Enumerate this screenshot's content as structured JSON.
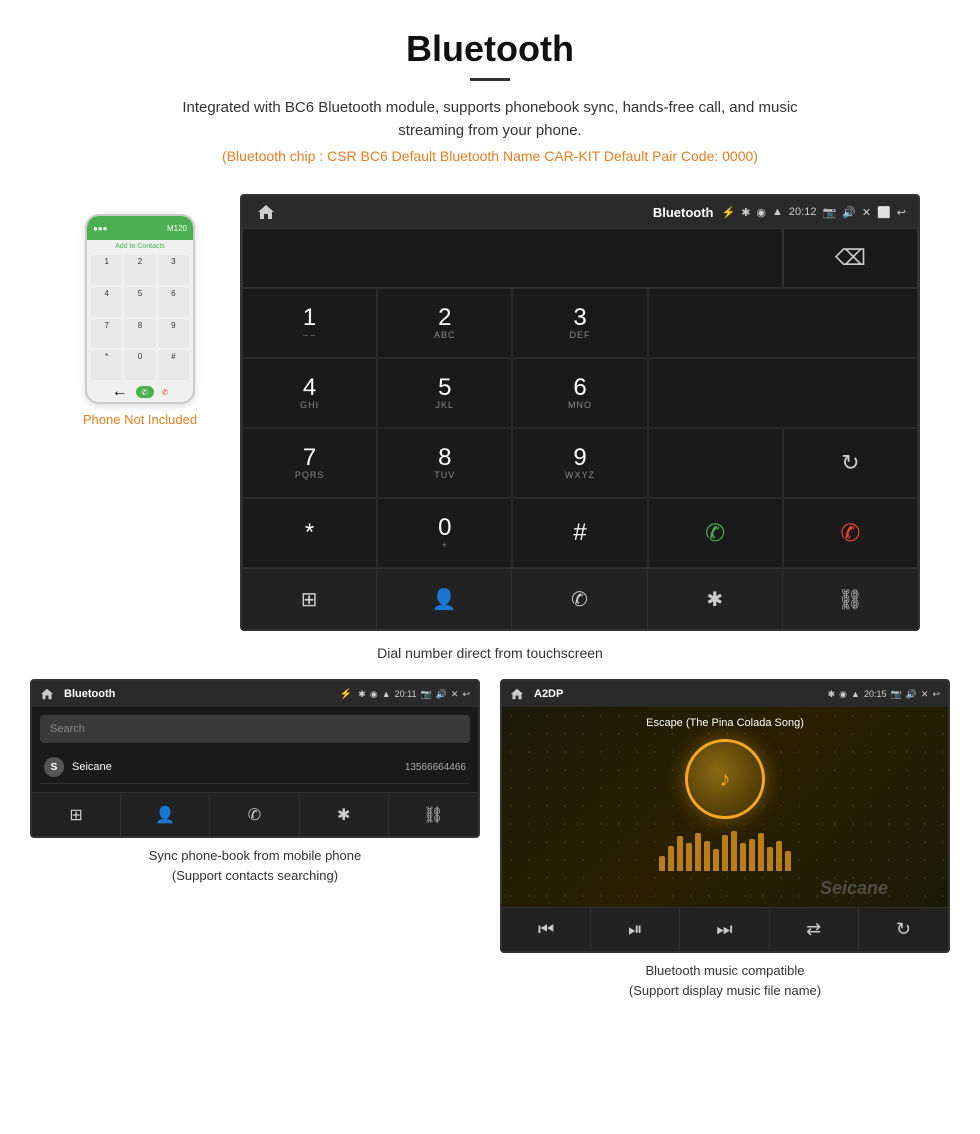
{
  "header": {
    "title": "Bluetooth",
    "description": "Integrated with BC6 Bluetooth module, supports phonebook sync, hands-free call, and music streaming from your phone.",
    "specs": "(Bluetooth chip : CSR BC6    Default Bluetooth Name CAR-KIT    Default Pair Code: 0000)"
  },
  "phone_mockup": {
    "not_included": "Phone Not Included",
    "contact_label": "Add to Contacts",
    "top_bar_label": "M120",
    "dial_keys": [
      "1",
      "2",
      "3",
      "4",
      "5",
      "6",
      "7",
      "8",
      "9",
      "*",
      "0",
      "#"
    ]
  },
  "dialer_screen": {
    "title": "Bluetooth",
    "time": "20:12",
    "keys": [
      {
        "number": "1",
        "letters": "◡◡"
      },
      {
        "number": "2",
        "letters": "ABC"
      },
      {
        "number": "3",
        "letters": "DEF"
      },
      {
        "number": "4",
        "letters": "GHI"
      },
      {
        "number": "5",
        "letters": "JKL"
      },
      {
        "number": "6",
        "letters": "MNO"
      },
      {
        "number": "7",
        "letters": "PQRS"
      },
      {
        "number": "8",
        "letters": "TUV"
      },
      {
        "number": "9",
        "letters": "WXYZ"
      },
      {
        "number": "*",
        "letters": ""
      },
      {
        "number": "0",
        "letters": "+"
      },
      {
        "number": "#",
        "letters": ""
      }
    ],
    "caption": "Dial number direct from touchscreen"
  },
  "phonebook_screen": {
    "title": "Bluetooth",
    "time": "20:11",
    "search_placeholder": "Search",
    "contacts": [
      {
        "letter": "S",
        "name": "Seicane",
        "number": "13566664466"
      }
    ],
    "caption_line1": "Sync phone-book from mobile phone",
    "caption_line2": "(Support contacts searching)"
  },
  "music_screen": {
    "title": "A2DP",
    "time": "20:15",
    "song_title": "Escape (The Pina Colada Song)",
    "caption_line1": "Bluetooth music compatible",
    "caption_line2": "(Support display music file name)"
  },
  "eq_bars": [
    15,
    25,
    35,
    28,
    38,
    30,
    22,
    36,
    40,
    28,
    32,
    38,
    24,
    30,
    20
  ],
  "colors": {
    "accent_orange": "#e67e22",
    "call_green": "#4caf50",
    "call_red": "#f44336",
    "screen_bg": "#1a1a1a",
    "status_bar": "#2a2a2a"
  }
}
